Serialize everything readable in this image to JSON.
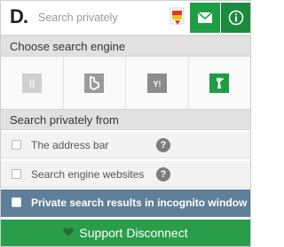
{
  "header": {
    "logo_text": "D.",
    "search_placeholder": "Search privately",
    "icons": [
      "flag-icon",
      "mail-icon",
      "info-icon"
    ]
  },
  "engine_section": {
    "title": "Choose search engine",
    "engines": [
      {
        "name": "google",
        "glyph": "8"
      },
      {
        "name": "bing",
        "glyph": "b"
      },
      {
        "name": "yahoo",
        "glyph": "Y!"
      },
      {
        "name": "duckduckgo",
        "selected": true
      }
    ],
    "selected_color": "#1f9d45"
  },
  "private_section": {
    "title": "Search privately from",
    "options": [
      {
        "label": "The address bar"
      },
      {
        "label": "Search engine websites"
      },
      {
        "label": "Private search results in incognito window"
      }
    ],
    "help_glyph": "?"
  },
  "support": {
    "label": "Support Disconnect"
  },
  "colors": {
    "accent_green": "#1f9d45",
    "incognito_blue": "#5f7f99"
  }
}
